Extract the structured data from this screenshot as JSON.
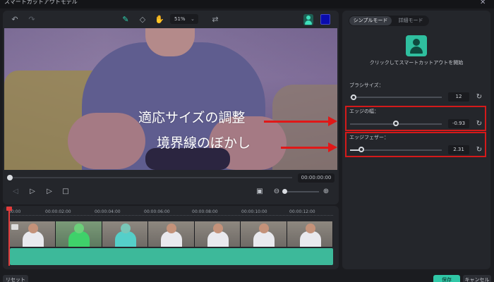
{
  "window": {
    "title": "スマートカットアウトモデル"
  },
  "toolbar": {
    "undo_icon": "undo-icon",
    "redo_icon": "redo-icon",
    "zoom": "51%",
    "accent_color": "#2fd3b0",
    "fill_color": "#0a0cae"
  },
  "video": {
    "annotations": [
      "適応サイズの調整",
      "境界線のぼかし"
    ],
    "arrow_color": "#e01818"
  },
  "playback": {
    "timecode": "00:00:00:00"
  },
  "timeline": {
    "ticks": [
      "00:00",
      "00:00:02:00",
      "00:00:04:00",
      "00:00:06:00",
      "00:00:08:00",
      "00:00:10:00",
      "00:00:12:00"
    ]
  },
  "panel": {
    "tabs": [
      {
        "label": "シンプルモード",
        "active": true
      },
      {
        "label": "詳細モード",
        "active": false
      }
    ],
    "start_label": "クリックしてスマートカットアウトを開始",
    "params": [
      {
        "label": "ブラシサイズ：",
        "value": "12",
        "position": 0.04
      },
      {
        "label": "エッジの幅：",
        "value": "-0.93",
        "position": 0.4
      },
      {
        "label": "エッジフェザー：",
        "value": "2.31",
        "position": 0.1
      }
    ]
  },
  "buttons": {
    "reset": "リセット",
    "save": "保存",
    "cancel": "キャンセル"
  }
}
